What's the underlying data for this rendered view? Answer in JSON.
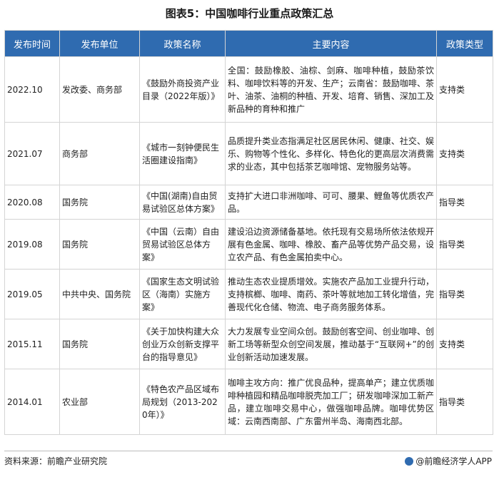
{
  "title": "图表5：中国咖啡行业重点政策汇总",
  "headers": [
    "发布时间",
    "发布单位",
    "政策名称",
    "主要内容",
    "政策类型"
  ],
  "rows": [
    {
      "date": "2022.10",
      "unit": "发改委、商务部",
      "name": "《鼓励外商投资产业目录（2022年版）》",
      "content": "全国：鼓励橡胶、油棕、剑麻、咖啡种植，鼓励茶饮料、咖啡饮料等的开发、生产；云南省：鼓励咖啡、茶叶、油茶、油桐的种植、开发、培育、销售、深加工及新品种的育种和推广",
      "type": "支持类"
    },
    {
      "date": "2021.07",
      "unit": "商务部",
      "name": "《城市一刻钟便民生活圈建设指南》",
      "content": "品质提升类业态指满足社区居民休闲、健康、社交、娱乐、购物等个性化、多样化、特色化的更高层次消费需求的业态，其中包括茶艺咖啡馆、宠物服务站等。",
      "type": "支持类"
    },
    {
      "date": "2020.08",
      "unit": "国务院",
      "name": "《中国(湖南)自由贸易试验区总体方案》",
      "content": "支持扩大进口非洲咖啡、可可、腰果、鲤鱼等优质农产品。",
      "type": "指导类"
    },
    {
      "date": "2019.08",
      "unit": "国务院",
      "name": "《中国（云南）自由贸易试验区总体方案》",
      "content": "建设沿边资源储备基地。依托现有交易场所依法依规开展有色金属、咖啡、橡胶、畜产品等优势产品交易，设立农产品、有色金属拍卖中心。",
      "type": "指导类"
    },
    {
      "date": "2019.05",
      "unit": "中共中央、国务院",
      "name": "《国家生态文明试验区（海南）实施方案》",
      "content": "推动生态农业提质增效。实施农产品加工业提升行动，支持槟榔、咖啡、南药、茶叶等就地加工转化增值，完善现代化仓储、物流、电子商务服务体系。",
      "type": "指导类"
    },
    {
      "date": "2015.11",
      "unit": "国务院",
      "name": "《关于加快构建大众创业万众创新支撑平台的指导意见》",
      "content": "大力发展专业空间众创。鼓励创客空间、创业咖啡、创新工场等新型众创空间发展，推动基于“互联网+”的创业创新活动加速发展。",
      "type": "支持类"
    },
    {
      "date": "2014.01",
      "unit": "农业部",
      "name": "《特色农产品区域布局规划（2013-2020年）》",
      "content": "咖啡主攻方向：推广优良品种，提高单产；建立优质咖啡种植园和精品咖啡脱壳加工厂；研发咖啡深加工新产品，建立咖啡交易中心，做强咖啡品牌。咖啡优势区域：云南西南部、广东雷州半岛、海南西北部。",
      "type": "指导类"
    }
  ],
  "footer": {
    "source": "资料来源：前瞻产业研究院",
    "brand": "@前瞻经济学人APP"
  },
  "colors": {
    "header_bg": "#2f6bb0",
    "border": "#d4d4d4"
  }
}
